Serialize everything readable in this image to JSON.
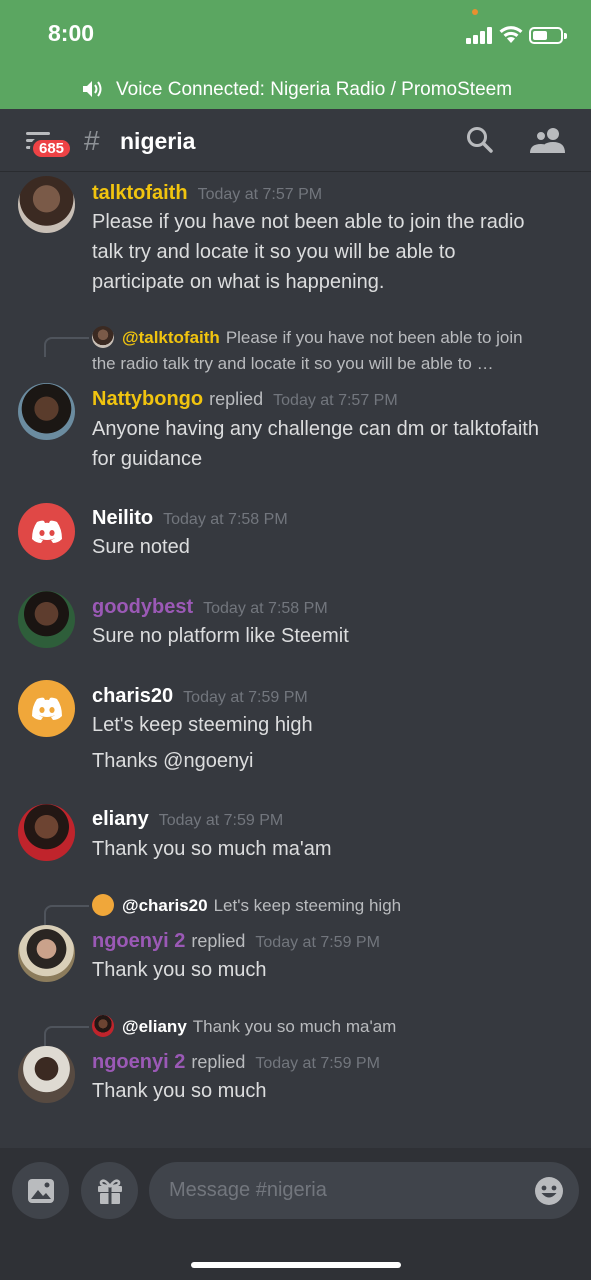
{
  "status_bar": {
    "time": "8:00"
  },
  "voice_bar": {
    "text": "Voice Connected: Nigeria Radio / PromoSteem"
  },
  "header": {
    "unread_count": "685",
    "hash": "#",
    "channel": "nigeria"
  },
  "colors": {
    "voice_green": "#5ba661",
    "background": "#36393f",
    "mention_yellow": "#f1c40f",
    "role_purple": "#9b59b6",
    "badge_red": "#ed4245"
  },
  "messages": [
    {
      "author": "talktofaith",
      "time": "Today at 7:57 PM",
      "lines": [
        "Please if you have not been able to join the radio",
        "talk try and locate it so you will be able to",
        "participate on what is happening."
      ]
    },
    {
      "reply_to": "@talktofaith",
      "reply_text_1": "Please if you have not been able to join",
      "reply_text_2": "the radio talk try and locate it so you will be able to …",
      "author": "Nattybongo",
      "replied": "replied",
      "time": "Today at 7:57 PM",
      "lines": [
        "Anyone having any challenge can dm or talktofaith",
        "for guidance"
      ]
    },
    {
      "author": "Neilito",
      "time": "Today at 7:58 PM",
      "lines": [
        "Sure noted"
      ]
    },
    {
      "author": "goodybest",
      "time": "Today at 7:58 PM",
      "lines": [
        "Sure no platform like Steemit"
      ]
    },
    {
      "author": "charis20",
      "time": "Today at 7:59 PM",
      "lines": [
        "Let's keep steeming high",
        "Thanks @ngoenyi"
      ]
    },
    {
      "author": "eliany",
      "time": "Today at 7:59 PM",
      "lines": [
        "Thank you so much ma'am"
      ]
    },
    {
      "reply_to": "@charis20",
      "reply_text": "Let's keep steeming high",
      "author": "ngoenyi 2",
      "replied": "replied",
      "time": "Today at 7:59 PM",
      "lines": [
        "Thank you so much"
      ]
    },
    {
      "reply_to": "@eliany",
      "reply_text": "Thank you so much ma'am",
      "author": "ngoenyi 2",
      "replied": "replied",
      "time": "Today at 7:59 PM",
      "lines": [
        "Thank you so much"
      ]
    }
  ],
  "composer": {
    "placeholder": "Message #nigeria"
  }
}
